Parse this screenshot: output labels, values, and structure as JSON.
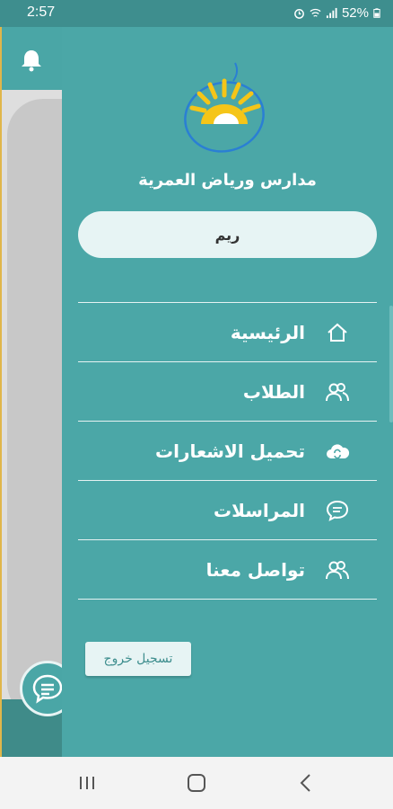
{
  "status_bar": {
    "time": "2:57",
    "battery": "52%",
    "icons": [
      "alarm-icon",
      "wifi-icon",
      "signal-icon",
      "battery-icon"
    ]
  },
  "drawer": {
    "school_name": "مدارس ورياض العمرية",
    "user_name": "ريم",
    "menu": [
      {
        "label": "الرئيسية",
        "icon": "home-icon"
      },
      {
        "label": "الطلاب",
        "icon": "users-icon"
      },
      {
        "label": "تحميل الاشعارات",
        "icon": "cloud-sync-icon"
      },
      {
        "label": "المراسلات",
        "icon": "chat-icon"
      },
      {
        "label": "تواصل معنا",
        "icon": "contact-users-icon"
      }
    ],
    "logout_label": "تسجيل خروج"
  },
  "colors": {
    "drawer_bg": "#4ba7a7",
    "status_bar": "#3e8e8e",
    "pill_bg": "#e7f4f4",
    "logo_sun": "#f5c518",
    "logo_ring": "#2a7fd4"
  },
  "nav_bar": {
    "buttons": [
      "recent-apps-icon",
      "home-button-icon",
      "back-icon"
    ]
  }
}
